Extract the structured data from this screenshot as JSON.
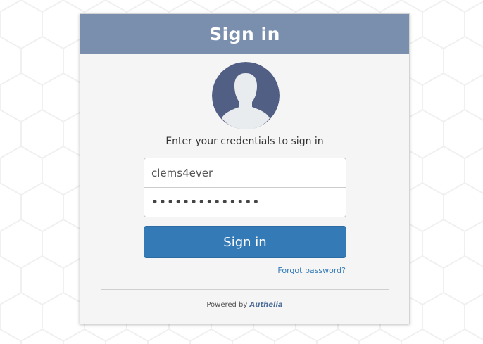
{
  "header": {
    "title": "Sign in"
  },
  "avatar": {
    "icon": "user-silhouette-icon"
  },
  "form": {
    "subtitle": "Enter your credentials to sign in",
    "username_value": "clems4ever",
    "password_value": "••••••••••••••",
    "signin_label": "Sign in",
    "forgot_label": "Forgot password?"
  },
  "footer": {
    "powered_prefix": "Powered by",
    "brand": "Authelia"
  },
  "colors": {
    "header_bg": "#7a8eae",
    "button_bg": "#337ab7",
    "link": "#337ab7",
    "avatar_bg": "#525f84"
  }
}
